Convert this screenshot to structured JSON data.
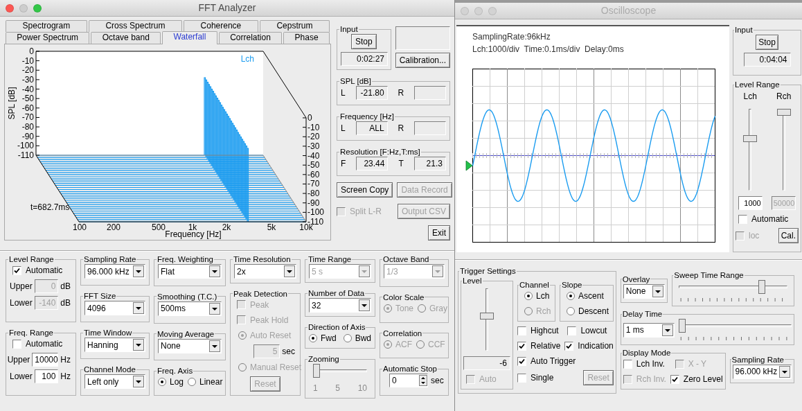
{
  "fft": {
    "title": "FFT Analyzer",
    "active": true,
    "tab_rows": [
      {
        "tabs": [
          {
            "label": "Spectrogram",
            "selected": false
          },
          {
            "label": "Cross Spectrum",
            "selected": false
          },
          {
            "label": "Coherence",
            "selected": false
          },
          {
            "label": "Cepstrum",
            "selected": false
          }
        ]
      },
      {
        "tabs": [
          {
            "label": "Power Spectrum",
            "selected": false
          },
          {
            "label": "Octave band",
            "selected": false
          },
          {
            "label": "Waterfall",
            "selected": true
          },
          {
            "label": "Correlation",
            "selected": false
          },
          {
            "label": "Phase",
            "selected": false
          }
        ]
      }
    ],
    "waterfall": {
      "channel": "Lch",
      "ylabel": "SPL [dB]",
      "yticks": [
        "0",
        "-10",
        "-20",
        "-30",
        "-40",
        "-50",
        "-60",
        "-70",
        "-80",
        "-90",
        "-100",
        "-110"
      ],
      "depth_ticks": [
        "0",
        "-10",
        "-20",
        "-30",
        "-40",
        "-50",
        "-60",
        "-70",
        "-80",
        "-90",
        "-100",
        "-110"
      ],
      "xticks": [
        "100",
        "200",
        "500",
        "1k",
        "2k",
        "5k",
        "10k"
      ],
      "xlabel": "Frequency [Hz]",
      "time": "t=682.7ms"
    },
    "side": [
      {
        "kind": "row",
        "items": [
          {
            "kind": "group",
            "title": "Input",
            "controls": [
              {
                "kind": "button",
                "label": "Stop",
                "disabled": false
              },
              {
                "kind": "readout",
                "value": "0:02:27"
              }
            ]
          },
          {
            "kind": "col",
            "items": [
              {
                "kind": "readout"
              },
              {
                "kind": "button",
                "label": "Calibration...",
                "disabled": false
              }
            ]
          }
        ]
      },
      {
        "kind": "group",
        "title": "SPL [dB]",
        "controls": [
          {
            "kind": "row",
            "items": [
              {
                "kind": "label",
                "text": "L"
              },
              {
                "kind": "readout",
                "value": "-21.80"
              },
              {
                "kind": "label",
                "text": "R"
              },
              {
                "kind": "readout"
              }
            ]
          }
        ]
      },
      {
        "kind": "group",
        "title": "Frequency [Hz]",
        "controls": [
          {
            "kind": "row",
            "items": [
              {
                "kind": "label",
                "text": "L"
              },
              {
                "kind": "readout",
                "value": "ALL"
              },
              {
                "kind": "label",
                "text": "R"
              },
              {
                "kind": "readout"
              }
            ]
          }
        ]
      },
      {
        "kind": "group",
        "title": "Resolution [F:Hz,T:ms]",
        "controls": [
          {
            "kind": "row",
            "items": [
              {
                "kind": "label",
                "text": "F"
              },
              {
                "kind": "readout",
                "value": "23.44"
              },
              {
                "kind": "label",
                "text": "T"
              },
              {
                "kind": "readout",
                "value": "21.3"
              }
            ]
          }
        ]
      },
      {
        "kind": "row",
        "items": [
          {
            "kind": "button",
            "label": "Screen Copy",
            "disabled": false
          },
          {
            "kind": "button",
            "label": "Data Record",
            "disabled": true
          }
        ]
      },
      {
        "kind": "row",
        "items": [
          {
            "kind": "checkbox",
            "label": "Split L-R",
            "checked": false,
            "disabled": true
          },
          {
            "kind": "button",
            "label": "Output CSV",
            "disabled": true
          }
        ]
      },
      {
        "kind": "row",
        "items": [
          {
            "kind": "button",
            "label": "Exit",
            "disabled": false
          }
        ]
      }
    ],
    "settings": [
      [
        {
          "kind": "group",
          "title": "Level Range",
          "controls": [
            {
              "kind": "checkbox",
              "label": "Automatic",
              "checked": true,
              "disabled": false
            },
            {
              "kind": "field",
              "label": "Upper",
              "value": "0",
              "unit": "dB",
              "disabled": true
            },
            {
              "kind": "field",
              "label": "Lower",
              "value": "-140",
              "unit": "dB",
              "disabled": true
            }
          ]
        },
        {
          "kind": "group",
          "title": "Freq. Range",
          "controls": [
            {
              "kind": "checkbox",
              "label": "Automatic",
              "checked": false,
              "disabled": false
            },
            {
              "kind": "field",
              "label": "Upper",
              "value": "10000",
              "unit": "Hz",
              "disabled": false
            },
            {
              "kind": "field",
              "label": "Lower",
              "value": "100",
              "unit": "Hz",
              "disabled": false
            }
          ]
        }
      ],
      [
        {
          "kind": "group",
          "title": "Sampling Rate",
          "controls": [
            {
              "kind": "dropdown",
              "value": "96.000 kHz",
              "disabled": false
            }
          ]
        },
        {
          "kind": "group",
          "title": "FFT Size",
          "controls": [
            {
              "kind": "dropdown",
              "value": "4096",
              "disabled": false
            }
          ]
        },
        {
          "kind": "group",
          "title": "Time Window",
          "controls": [
            {
              "kind": "dropdown",
              "value": "Hanning",
              "disabled": false
            }
          ]
        },
        {
          "kind": "group",
          "title": "Channel Mode",
          "controls": [
            {
              "kind": "dropdown",
              "value": "Left only",
              "disabled": false
            }
          ]
        }
      ],
      [
        {
          "kind": "group",
          "title": "Freq. Weighting",
          "controls": [
            {
              "kind": "dropdown",
              "value": "Flat",
              "disabled": false
            }
          ]
        },
        {
          "kind": "group",
          "title": "Smoothing (T.C.)",
          "controls": [
            {
              "kind": "dropdown",
              "value": "500ms",
              "disabled": false
            }
          ]
        },
        {
          "kind": "group",
          "title": "Moving Average",
          "controls": [
            {
              "kind": "dropdown",
              "value": "None",
              "disabled": false
            }
          ]
        },
        {
          "kind": "group",
          "title": "Freq. Axis",
          "controls": [
            {
              "kind": "row",
              "items": [
                {
                  "kind": "radio",
                  "label": "Log",
                  "selected": true,
                  "disabled": false
                },
                {
                  "kind": "radio",
                  "label": "Linear",
                  "selected": false,
                  "disabled": false
                }
              ]
            }
          ]
        }
      ],
      [
        {
          "kind": "group",
          "title": "Time Resolution",
          "controls": [
            {
              "kind": "dropdown",
              "value": "2x",
              "disabled": false
            }
          ]
        },
        {
          "kind": "group",
          "title": "Peak Detection",
          "controls": [
            {
              "kind": "checkbox",
              "label": "Peak",
              "checked": false,
              "disabled": true
            },
            {
              "kind": "checkbox",
              "label": "Peak Hold",
              "checked": false,
              "disabled": true
            },
            {
              "kind": "radio",
              "label": "Auto Reset",
              "selected": true,
              "disabled": true
            },
            {
              "kind": "field",
              "value": "5",
              "unit": "sec",
              "disabled": true
            },
            {
              "kind": "radio",
              "label": "Manual Reset",
              "selected": false,
              "disabled": true
            },
            {
              "kind": "button",
              "label": "Reset",
              "disabled": true
            }
          ]
        }
      ],
      [
        {
          "kind": "group",
          "title": "Time Range",
          "controls": [
            {
              "kind": "dropdown",
              "value": "5 s",
              "disabled": true
            }
          ]
        },
        {
          "kind": "group",
          "title": "Number of Data",
          "controls": [
            {
              "kind": "dropdown",
              "value": "32",
              "disabled": false
            }
          ]
        },
        {
          "kind": "group",
          "title": "Direction of Axis",
          "controls": [
            {
              "kind": "row",
              "items": [
                {
                  "kind": "radio",
                  "label": "Fwd",
                  "selected": true,
                  "disabled": false
                },
                {
                  "kind": "radio",
                  "label": "Bwd",
                  "selected": false,
                  "disabled": false
                }
              ]
            }
          ]
        },
        {
          "kind": "group",
          "title": "Zooming",
          "controls": [
            {
              "kind": "slider",
              "level": 0,
              "ticks": false,
              "scale": [
                "1",
                "5",
                "10"
              ]
            }
          ]
        }
      ],
      [
        {
          "kind": "group",
          "title": "Octave Band",
          "controls": [
            {
              "kind": "dropdown",
              "value": "1/3",
              "disabled": true
            }
          ]
        },
        {
          "kind": "group",
          "title": "Color Scale",
          "controls": [
            {
              "kind": "row",
              "items": [
                {
                  "kind": "radio",
                  "label": "Tone",
                  "selected": true,
                  "disabled": true
                },
                {
                  "kind": "radio",
                  "label": "Gray",
                  "selected": false,
                  "disabled": true
                }
              ]
            }
          ]
        },
        {
          "kind": "group",
          "title": "Correlation",
          "controls": [
            {
              "kind": "row",
              "items": [
                {
                  "kind": "radio",
                  "label": "ACF",
                  "selected": true,
                  "disabled": true
                },
                {
                  "kind": "radio",
                  "label": "CCF",
                  "selected": false,
                  "disabled": true
                }
              ]
            }
          ]
        },
        {
          "kind": "group",
          "title": "Automatic Stop",
          "controls": [
            {
              "kind": "spinner",
              "value": "0",
              "unit": "sec"
            }
          ]
        }
      ]
    ]
  },
  "scope": {
    "title": "Oscilloscope",
    "active": false,
    "display": {
      "info": [
        "SamplingRate:96kHz",
        "Lch:1000/div  Time:0.1ms/div  Delay:0ms"
      ]
    },
    "side": [
      {
        "kind": "group",
        "title": "Input",
        "controls": [
          {
            "kind": "button",
            "label": "Stop",
            "disabled": false
          },
          {
            "kind": "readout",
            "value": "0:04:04"
          }
        ]
      },
      {
        "kind": "group",
        "title": "Level Range",
        "controls": [
          {
            "kind": "row",
            "items": [
              {
                "kind": "col",
                "items": [
                  {
                    "kind": "label",
                    "text": "Lch"
                  },
                  {
                    "kind": "vslider",
                    "level": 0.65
                  },
                  {
                    "kind": "field",
                    "value": "1000",
                    "disabled": false
                  }
                ]
              },
              {
                "kind": "col",
                "items": [
                  {
                    "kind": "label",
                    "text": "Rch"
                  },
                  {
                    "kind": "vslider",
                    "level": 1
                  },
                  {
                    "kind": "field",
                    "value": "50000",
                    "disabled": true
                  }
                ]
              }
            ]
          },
          {
            "kind": "checkbox",
            "label": "Automatic",
            "checked": false,
            "disabled": false
          },
          {
            "kind": "row",
            "items": [
              {
                "kind": "checkbox",
                "label": "loc",
                "checked": false,
                "disabled": true
              },
              {
                "kind": "button",
                "label": "Cal.",
                "disabled": false
              }
            ]
          }
        ]
      }
    ],
    "settings": {
      "kind": "row",
      "items": [
        {
          "kind": "group",
          "title": "Trigger Settings",
          "controls": [
            {
              "kind": "row",
              "items": [
                {
                  "kind": "group",
                  "title": "Level",
                  "controls": [
                    {
                      "kind": "vslider",
                      "level": 0.56
                    },
                    {
                      "kind": "readout",
                      "value": "-6"
                    },
                    {
                      "kind": "checkbox",
                      "label": "Auto",
                      "checked": false,
                      "disabled": true
                    }
                  ]
                },
                {
                  "kind": "col",
                  "items": [
                    {
                      "kind": "row",
                      "items": [
                        {
                          "kind": "group",
                          "title": "Channel",
                          "controls": [
                            {
                              "kind": "radio",
                              "label": "Lch",
                              "selected": true,
                              "disabled": false
                            },
                            {
                              "kind": "radio",
                              "label": "Rch",
                              "selected": false,
                              "disabled": true
                            }
                          ]
                        },
                        {
                          "kind": "group",
                          "title": "Slope",
                          "controls": [
                            {
                              "kind": "radio",
                              "label": "Ascent",
                              "selected": true,
                              "disabled": false
                            },
                            {
                              "kind": "radio",
                              "label": "Descent",
                              "selected": false,
                              "disabled": false
                            }
                          ]
                        }
                      ]
                    },
                    {
                      "kind": "row",
                      "items": [
                        {
                          "kind": "checkbox",
                          "label": "Highcut",
                          "checked": false,
                          "disabled": false
                        },
                        {
                          "kind": "checkbox",
                          "label": "Lowcut",
                          "checked": false,
                          "disabled": false
                        }
                      ]
                    },
                    {
                      "kind": "row",
                      "items": [
                        {
                          "kind": "checkbox",
                          "label": "Relative",
                          "checked": true,
                          "disabled": false
                        },
                        {
                          "kind": "checkbox",
                          "label": "Indication",
                          "checked": true,
                          "disabled": false
                        }
                      ]
                    },
                    {
                      "kind": "row",
                      "items": [
                        {
                          "kind": "checkbox",
                          "label": "Auto Trigger",
                          "checked": true,
                          "disabled": false
                        }
                      ]
                    },
                    {
                      "kind": "row",
                      "items": [
                        {
                          "kind": "checkbox",
                          "label": "Single",
                          "checked": false,
                          "disabled": false
                        },
                        {
                          "kind": "button",
                          "label": "Reset",
                          "disabled": true
                        }
                      ]
                    }
                  ]
                }
              ]
            }
          ]
        },
        {
          "kind": "col",
          "items": [
            {
              "kind": "row",
              "items": [
                {
                  "kind": "group",
                  "title": "Overlay",
                  "controls": [
                    {
                      "kind": "dropdown",
                      "value": "None",
                      "disabled": false
                    }
                  ]
                },
                {
                  "kind": "group",
                  "title": "Sweep Time Range",
                  "controls": [
                    {
                      "kind": "slider",
                      "level": 0.78,
                      "ticks": true
                    }
                  ]
                }
              ]
            },
            {
              "kind": "group",
              "title": "Delay Time",
              "controls": [
                {
                  "kind": "row",
                  "items": [
                    {
                      "kind": "dropdown",
                      "value": "1 ms",
                      "disabled": false
                    },
                    {
                      "kind": "slider",
                      "level": 0,
                      "ticks": true
                    }
                  ]
                }
              ]
            },
            {
              "kind": "row",
              "items": [
                {
                  "kind": "group",
                  "title": "Display Mode",
                  "controls": [
                    {
                      "kind": "row",
                      "items": [
                        {
                          "kind": "checkbox",
                          "label": "Lch Inv.",
                          "checked": false,
                          "disabled": false
                        },
                        {
                          "kind": "checkbox",
                          "label": "X - Y",
                          "checked": false,
                          "disabled": true
                        }
                      ]
                    },
                    {
                      "kind": "row",
                      "items": [
                        {
                          "kind": "checkbox",
                          "label": "Rch Inv.",
                          "checked": false,
                          "disabled": true
                        },
                        {
                          "kind": "checkbox",
                          "label": "Zero Level",
                          "checked": true,
                          "disabled": false
                        }
                      ]
                    }
                  ]
                },
                {
                  "kind": "group",
                  "title": "Sampling Rate",
                  "controls": [
                    {
                      "kind": "dropdown",
                      "value": "96.000 kHz",
                      "disabled": false
                    }
                  ]
                }
              ]
            }
          ]
        }
      ]
    }
  }
}
